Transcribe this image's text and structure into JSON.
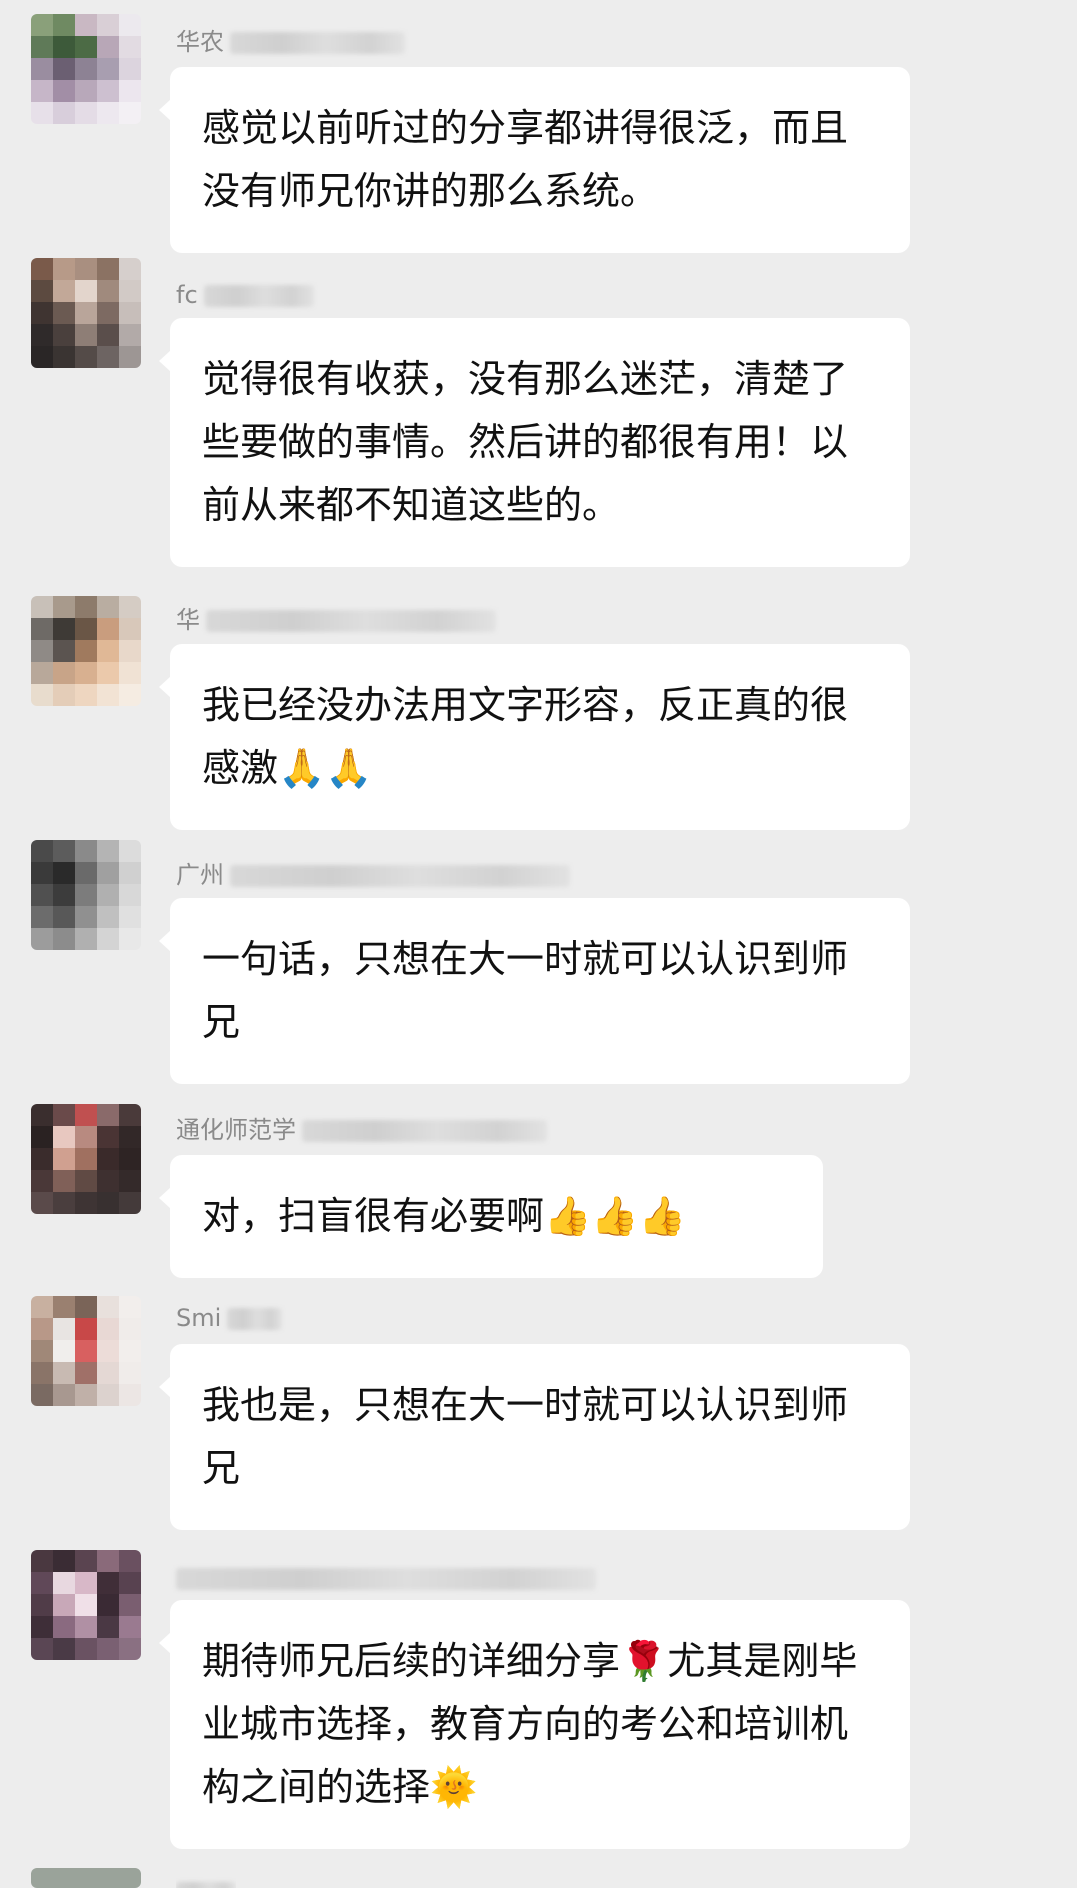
{
  "colors": {
    "background": "#ededed",
    "bubble": "#ffffff",
    "text": "#111111",
    "sender": "#8a8a8a"
  },
  "messages": [
    {
      "sender_visible": "华农",
      "avatar_colors": [
        "#8aa07a",
        "#6f8a62",
        "#c9b8c3",
        "#d9cfd6",
        "#ece9ee",
        "#5f7a58",
        "#3d5a3a",
        "#4c6b45",
        "#b8a7b7",
        "#e2dbe2",
        "#9a8da0",
        "#6b5f72",
        "#8d8294",
        "#a89eb0",
        "#dcd4de",
        "#c6b6c8",
        "#a28ea6",
        "#b8a8ba",
        "#cdc0d0",
        "#ece6ee",
        "#e7e0e9",
        "#d8cedb",
        "#e4dce6",
        "#ede8ef",
        "#f3f0f4"
      ],
      "text": "感觉以前听过的分享都讲得很泛，而且没有师兄你讲的那么系统。"
    },
    {
      "sender_visible": "fc",
      "avatar_colors": [
        "#7a5a4a",
        "#b79a88",
        "#a98f80",
        "#8b7263",
        "#d6cfcc",
        "#5c4a40",
        "#c2a898",
        "#e3d5cc",
        "#a08a7d",
        "#d2cac6",
        "#3f3431",
        "#6b5a52",
        "#b9a59a",
        "#7d6a62",
        "#c7beba",
        "#2f2a2a",
        "#4a403d",
        "#8e7e76",
        "#5a4e4b",
        "#b2aaa8",
        "#2a2626",
        "#3a3432",
        "#544b48",
        "#6d6462",
        "#9d9694"
      ],
      "text": "觉得很有收获，没有那么迷茫，清楚了些要做的事情。然后讲的都很有用！以前从来都不知道这些的。"
    },
    {
      "sender_visible": "华",
      "avatar_colors": [
        "#c8c0b8",
        "#a89a8c",
        "#8d7b6b",
        "#b9ada1",
        "#d5ccc4",
        "#6e6a66",
        "#3e3a36",
        "#6a5646",
        "#c99d7e",
        "#d8c8ba",
        "#8f8a86",
        "#5b5450",
        "#a07a5e",
        "#e0b896",
        "#e8d8ca",
        "#b8a89a",
        "#c8a488",
        "#d8b090",
        "#ebc9ab",
        "#f0e2d4",
        "#e8dccd",
        "#e4cdb8",
        "#eed6c0",
        "#f2e3d4",
        "#f5ece2"
      ],
      "text": "我已经没办法用文字形容，反正真的很感激🙏🙏"
    },
    {
      "sender_visible": "广州",
      "avatar_colors": [
        "#4a4a4a",
        "#5c5c5c",
        "#8a8a8a",
        "#b4b4b4",
        "#dcdcdc",
        "#3a3a3a",
        "#2a2a2a",
        "#6a6a6a",
        "#a0a0a0",
        "#d0d0d0",
        "#505050",
        "#3c3c3c",
        "#7c7c7c",
        "#b0b0b0",
        "#d8d8d8",
        "#6c6c6c",
        "#585858",
        "#909090",
        "#c0c0c0",
        "#e0e0e0",
        "#9c9c9c",
        "#8c8c8c",
        "#b0b0b0",
        "#d4d4d4",
        "#e8e8e8"
      ],
      "text": "一句话，只想在大一时就可以认识到师兄"
    },
    {
      "sender_visible": "通化师范学",
      "avatar_colors": [
        "#3a2e2e",
        "#6a4a4a",
        "#c05050",
        "#8a6a6a",
        "#4a3a3a",
        "#2a2222",
        "#e8c8c0",
        "#b88a80",
        "#4a3434",
        "#322828",
        "#3a2c2c",
        "#d0a090",
        "#a07060",
        "#3a2a2a",
        "#2e2424",
        "#4a3838",
        "#806058",
        "#604a44",
        "#3e3030",
        "#342a2a",
        "#5a4a4a",
        "#4a3e3e",
        "#3e3434",
        "#383030",
        "#443a3a"
      ],
      "text": "对，扫盲很有必要啊👍👍👍"
    },
    {
      "sender_visible": "Smi",
      "avatar_colors": [
        "#c8b0a0",
        "#9a8070",
        "#7a6458",
        "#e8e0dc",
        "#f2eeec",
        "#b89888",
        "#e8e4e2",
        "#c84848",
        "#e8d8d4",
        "#f0ecea",
        "#a08878",
        "#f0eeec",
        "#d86060",
        "#ecdcd8",
        "#f2eeec",
        "#8a7468",
        "#c8bab2",
        "#a07068",
        "#e4d8d4",
        "#f0ecea",
        "#7a6a62",
        "#a89890",
        "#c0b0a8",
        "#dcd2ce",
        "#ece6e4"
      ],
      "text": "我也是，只想在大一时就可以认识到师兄"
    },
    {
      "sender_visible": "",
      "avatar_colors": [
        "#4a3840",
        "#3a2c34",
        "#5a4450",
        "#8a6a7a",
        "#6a5060",
        "#604858",
        "#e8d8e0",
        "#d8b8c8",
        "#402e38",
        "#584250",
        "#503c48",
        "#c8a8b8",
        "#f0e0e8",
        "#3a2a34",
        "#7a5e70",
        "#3e2e38",
        "#8a6a80",
        "#b090a4",
        "#4a3844",
        "#9a7a90",
        "#5a4654",
        "#4a3a46",
        "#6a5262",
        "#7a6072",
        "#8a7082"
      ],
      "text": "期待师兄后续的详细分享🌹尤其是刚毕业城市选择，教育方向的考公和培训机构之间的选择🌞"
    }
  ]
}
